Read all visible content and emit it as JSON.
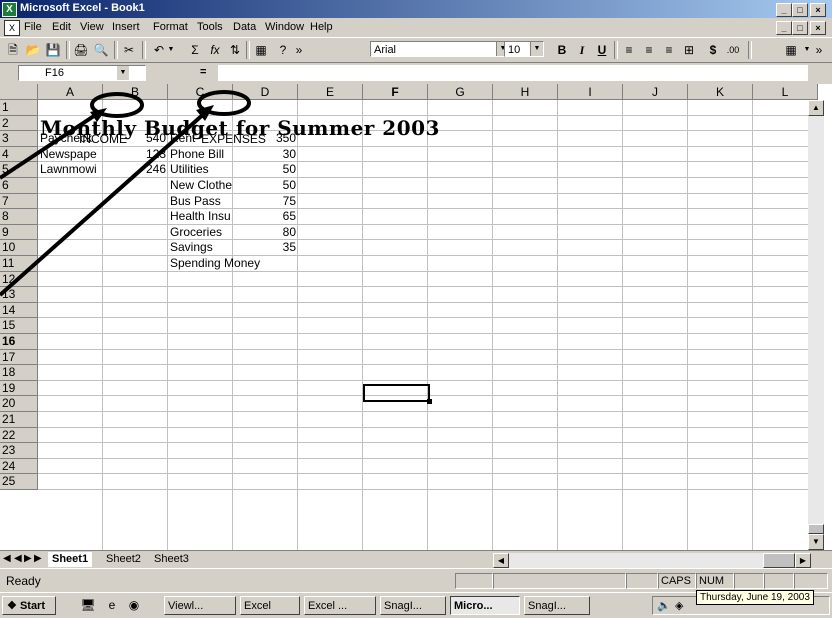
{
  "window": {
    "title": "Microsoft Excel - Book1",
    "controls": [
      "_",
      "□",
      "×"
    ]
  },
  "menu": [
    "File",
    "Edit",
    "View",
    "Insert",
    "Format",
    "Tools",
    "Data",
    "Window",
    "Help"
  ],
  "toolbar": {
    "font_name": "Arial",
    "font_size": "10",
    "bold": "B",
    "italic": "I",
    "underline": "U",
    "currency": "$"
  },
  "formula_bar": {
    "name_box": "F16",
    "equals": "=",
    "value": ""
  },
  "columns": [
    "A",
    "B",
    "C",
    "D",
    "E",
    "F",
    "G",
    "H",
    "I",
    "J",
    "K",
    "L"
  ],
  "rows": [
    "1",
    "2",
    "3",
    "4",
    "5",
    "6",
    "7",
    "8",
    "9",
    "10",
    "11",
    "12",
    "13",
    "14",
    "15",
    "16",
    "17",
    "18",
    "19",
    "20",
    "21",
    "22",
    "23",
    "24",
    "25"
  ],
  "active_cell": {
    "col": "F",
    "row": "16"
  },
  "sheet": {
    "title": "Monthly Budget for Summer 2003",
    "income_header": "INCOME",
    "expenses_header": "EXPENSES",
    "income": [
      {
        "label": "Paycheck",
        "amount": "540"
      },
      {
        "label": "Newspape",
        "amount": "123"
      },
      {
        "label": "Lawnmowi",
        "amount": "246"
      }
    ],
    "expenses": [
      {
        "label": "Rent",
        "amount": "350"
      },
      {
        "label": "Phone Bill",
        "amount": "30"
      },
      {
        "label": "Utilities",
        "amount": "50"
      },
      {
        "label": "New Clothe",
        "amount": "50"
      },
      {
        "label": "Bus Pass",
        "amount": "75"
      },
      {
        "label": "Health Insu",
        "amount": "65"
      },
      {
        "label": "Groceries",
        "amount": "80"
      },
      {
        "label": "Savings",
        "amount": "35"
      },
      {
        "label": "Spending Money",
        "amount": ""
      }
    ]
  },
  "sheet_tabs": [
    "Sheet1",
    "Sheet2",
    "Sheet3"
  ],
  "status": {
    "text": "Ready",
    "caps": "CAPS",
    "num": "NUM"
  },
  "taskbar": {
    "start": "Start",
    "tasks": [
      "Viewl...",
      "Excel",
      "Excel ...",
      "SnagI...",
      "Micro...",
      "SnagI..."
    ],
    "tooltip": "Thursday, June 19, 2003"
  }
}
